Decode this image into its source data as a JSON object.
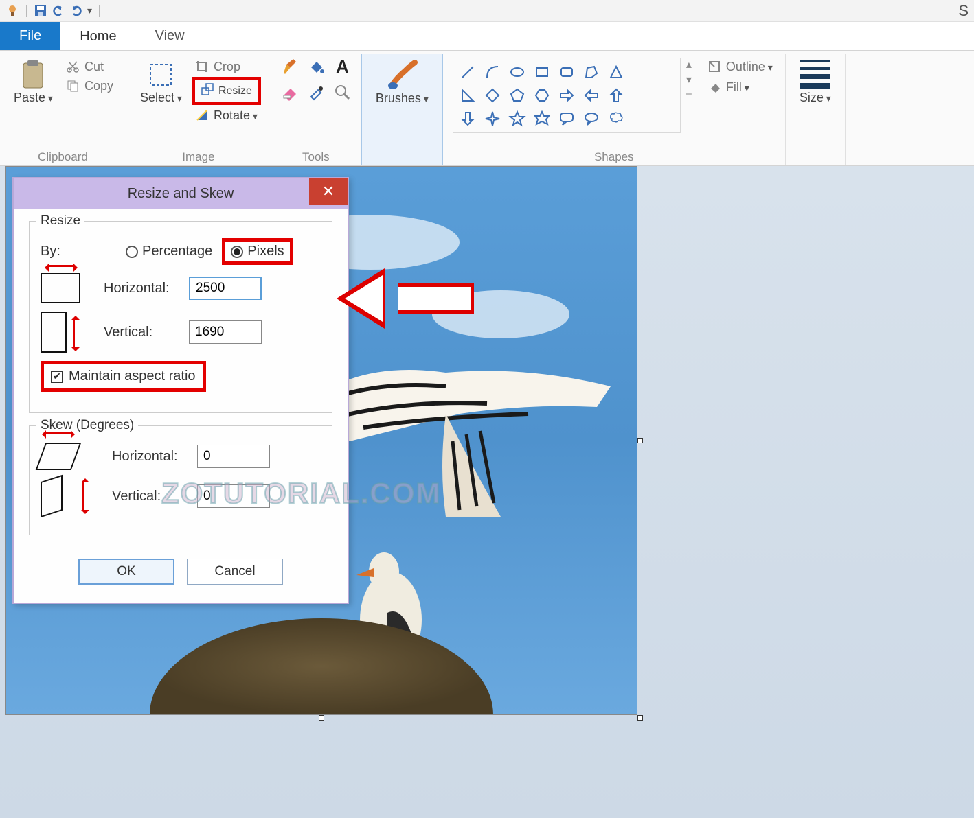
{
  "app_partial_title": "S",
  "qat": {
    "save": "💾",
    "undo": "↶",
    "redo": "↷"
  },
  "tabs": {
    "file": "File",
    "home": "Home",
    "view": "View"
  },
  "ribbon": {
    "clipboard": {
      "label": "Clipboard",
      "paste": "Paste",
      "cut": "Cut",
      "copy": "Copy"
    },
    "image": {
      "label": "Image",
      "select": "Select",
      "crop": "Crop",
      "resize": "Resize",
      "rotate": "Rotate"
    },
    "tools": {
      "label": "Tools"
    },
    "brushes": {
      "label": "Brushes"
    },
    "shapes": {
      "label": "Shapes",
      "outline": "Outline",
      "fill": "Fill"
    },
    "size": {
      "label": "Size"
    }
  },
  "dialog": {
    "title": "Resize and Skew",
    "resize_legend": "Resize",
    "by_label": "By:",
    "percentage": "Percentage",
    "pixels": "Pixels",
    "horizontal": "Horizontal:",
    "vertical": "Vertical:",
    "h_value": "2500",
    "v_value": "1690",
    "maintain": "Maintain aspect ratio",
    "skew_legend": "Skew (Degrees)",
    "skew_h": "0",
    "skew_v": "0",
    "ok": "OK",
    "cancel": "Cancel"
  },
  "watermark": "ZOTUTORIAL.COM"
}
